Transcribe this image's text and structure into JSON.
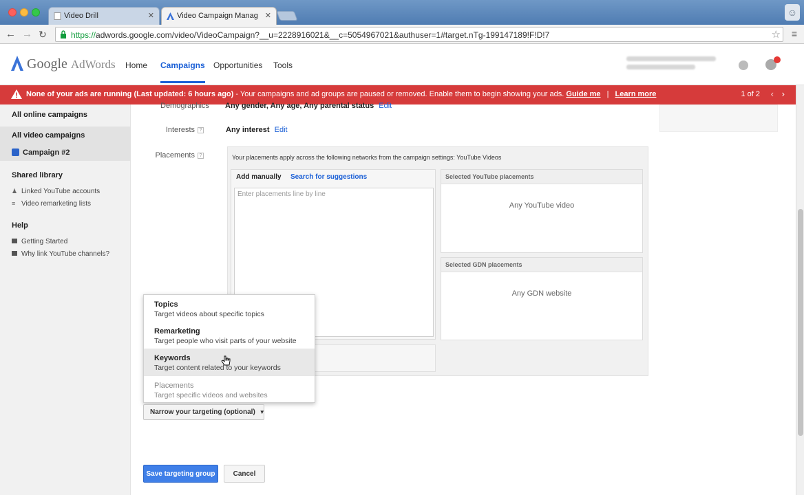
{
  "browser": {
    "tabs": [
      {
        "title": "Video Drill"
      },
      {
        "title": "Video Campaign Manag"
      }
    ],
    "url_scheme": "https://",
    "url_rest": "adwords.google.com/video/VideoCampaign?__u=2228916021&__c=5054967021&authuser=1#target.nTg-199147189!F!D!7"
  },
  "header": {
    "logo_google": "Google",
    "logo_adwords": "AdWords",
    "nav": {
      "home": "Home",
      "campaigns": "Campaigns",
      "opportunities": "Opportunities",
      "tools": "Tools"
    }
  },
  "alert": {
    "bold_text": "None of your ads are running (Last updated: 6 hours ago)",
    "message": " - Your campaigns and ad groups are paused or removed. Enable them to begin showing your ads.",
    "guide_me": "Guide me",
    "separator": "|",
    "learn_more": "Learn more",
    "pager": "1 of 2",
    "prev_icon": "‹",
    "next_icon": "›"
  },
  "sidebar": {
    "all_online": "All online campaigns",
    "all_video": "All video campaigns",
    "campaign": "Campaign #2",
    "shared_library": "Shared library",
    "linked_youtube": "Linked YouTube accounts",
    "video_remarketing": "Video remarketing lists",
    "help": "Help",
    "getting_started": "Getting Started",
    "why_link": "Why link YouTube channels?"
  },
  "targeting": {
    "demographics_label": "Demographics",
    "demographics_value": "Any gender, Any age, Any parental status",
    "demographics_edit": "Edit",
    "interests_label": "Interests",
    "interests_value": "Any interest",
    "interests_edit": "Edit",
    "placements_label": "Placements",
    "help_mark": "?"
  },
  "placements": {
    "note": "Your placements apply across the following networks from the campaign settings: YouTube Videos",
    "tab_add": "Add manually",
    "tab_search": "Search for suggestions",
    "textarea_placeholder": "Enter placements line by line",
    "yt_header": "Selected YouTube placements",
    "yt_value": "Any YouTube video",
    "gdn_header": "Selected GDN placements",
    "gdn_value": "Any GDN website"
  },
  "dropdown": {
    "items": [
      {
        "title": "Topics",
        "desc": "Target videos about specific topics"
      },
      {
        "title": "Remarketing",
        "desc": "Target people who visit parts of your website"
      },
      {
        "title": "Keywords",
        "desc": "Target content related to your keywords"
      },
      {
        "title": "Placements",
        "desc": "Target specific videos and websites"
      }
    ]
  },
  "buttons": {
    "narrow": "Narrow your targeting (optional)",
    "narrow_caret": "▼",
    "save": "Save targeting group",
    "cancel": "Cancel"
  },
  "colors": {
    "brand_blue": "#1a5fd6",
    "alert_red": "#d63b3b",
    "save_blue": "#3f7fe8"
  }
}
